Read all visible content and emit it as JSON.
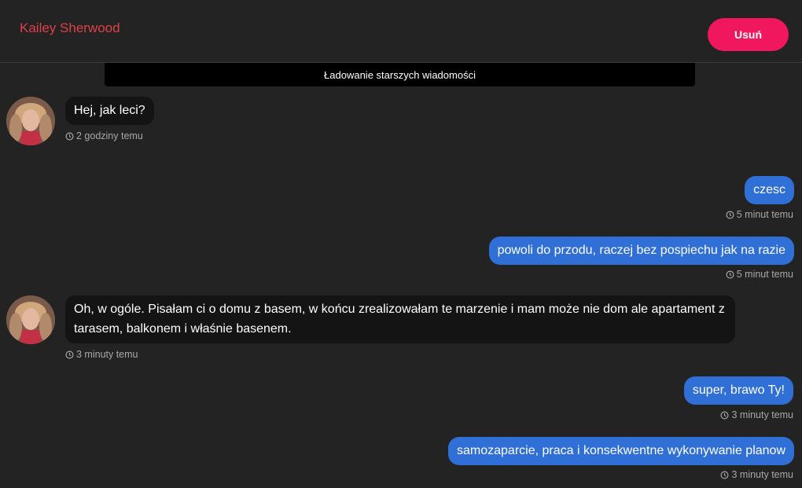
{
  "header": {
    "contact_name": "Kailey Sherwood",
    "delete_label": "Usuń"
  },
  "load_older_label": "Ładowanie starszych wiadomości",
  "colors": {
    "background": "#232323",
    "accent_name": "#e0404a",
    "delete_button": "#f0175e",
    "outgoing_bubble": "#2f6fd6",
    "incoming_bubble": "#141414"
  },
  "messages": [
    {
      "direction": "incoming",
      "text": "Hej, jak leci?",
      "time": "2 godziny temu",
      "icon": "clock-icon"
    },
    {
      "direction": "outgoing",
      "text": "czesc",
      "time": "5 minut temu",
      "icon": "clock-icon"
    },
    {
      "direction": "outgoing",
      "text": "powoli do przodu, raczej bez pospiechu jak na razie",
      "time": "5 minut temu",
      "icon": "clock-icon"
    },
    {
      "direction": "incoming",
      "text": "Oh, w ogóle. Pisałam ci o domu z basem, w końcu zrealizowałam te marzenie i mam może nie dom ale apartament z tarasem, balkonem i właśnie basenem.",
      "time": "3 minuty temu",
      "icon": "clock-icon"
    },
    {
      "direction": "outgoing",
      "text": "super, brawo Ty!",
      "time": "3 minuty temu",
      "icon": "clock-icon"
    },
    {
      "direction": "outgoing",
      "text": "samozaparcie, praca i konsekwentne wykonywanie planow",
      "time": "3 minuty temu",
      "icon": "clock-icon"
    }
  ]
}
